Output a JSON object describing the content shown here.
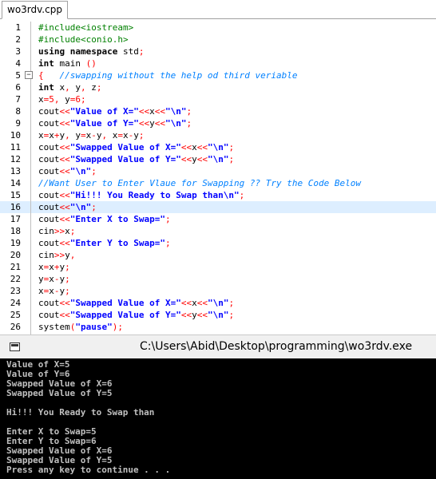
{
  "editor": {
    "tab_label": "wo3rdv.cpp",
    "highlighted_line": 16,
    "lines": [
      {
        "n": "1",
        "parts": [
          [
            "pp",
            "#include<iostream>"
          ]
        ]
      },
      {
        "n": "2",
        "parts": [
          [
            "pp",
            "#include<conio.h>"
          ]
        ]
      },
      {
        "n": "3",
        "parts": [
          [
            "kw",
            "using namespace"
          ],
          [
            "pl",
            " std"
          ],
          [
            "op",
            ";"
          ]
        ]
      },
      {
        "n": "4",
        "parts": [
          [
            "kw",
            "int"
          ],
          [
            "pl",
            " main "
          ],
          [
            "op",
            "()"
          ]
        ]
      },
      {
        "n": "5",
        "parts": [
          [
            "op",
            "{"
          ],
          [
            "cm",
            "   //swapping without the help od third veriable"
          ]
        ]
      },
      {
        "n": "6",
        "parts": [
          [
            "kw",
            "int"
          ],
          [
            "pl",
            " x"
          ],
          [
            "op",
            ","
          ],
          [
            "pl",
            " y"
          ],
          [
            "op",
            ","
          ],
          [
            "pl",
            " z"
          ],
          [
            "op",
            ";"
          ]
        ]
      },
      {
        "n": "7",
        "parts": [
          [
            "pl",
            "x"
          ],
          [
            "op",
            "="
          ],
          [
            "nm",
            "5"
          ],
          [
            "op",
            ","
          ],
          [
            "pl",
            " y"
          ],
          [
            "op",
            "="
          ],
          [
            "nm",
            "6"
          ],
          [
            "op",
            ";"
          ]
        ]
      },
      {
        "n": "8",
        "parts": [
          [
            "pl",
            "cout"
          ],
          [
            "op",
            "<<"
          ],
          [
            "st",
            "\"Value of X=\""
          ],
          [
            "op",
            "<<"
          ],
          [
            "pl",
            "x"
          ],
          [
            "op",
            "<<"
          ],
          [
            "st",
            "\"\\n\""
          ],
          [
            "op",
            ";"
          ]
        ]
      },
      {
        "n": "9",
        "parts": [
          [
            "pl",
            "cout"
          ],
          [
            "op",
            "<<"
          ],
          [
            "st",
            "\"Value of Y=\""
          ],
          [
            "op",
            "<<"
          ],
          [
            "pl",
            "y"
          ],
          [
            "op",
            "<<"
          ],
          [
            "st",
            "\"\\n\""
          ],
          [
            "op",
            ";"
          ]
        ]
      },
      {
        "n": "10",
        "parts": [
          [
            "pl",
            "x"
          ],
          [
            "op",
            "="
          ],
          [
            "pl",
            "x"
          ],
          [
            "op",
            "+"
          ],
          [
            "pl",
            "y"
          ],
          [
            "op",
            ","
          ],
          [
            "pl",
            " y"
          ],
          [
            "op",
            "="
          ],
          [
            "pl",
            "x"
          ],
          [
            "op",
            "-"
          ],
          [
            "pl",
            "y"
          ],
          [
            "op",
            ","
          ],
          [
            "pl",
            " x"
          ],
          [
            "op",
            "="
          ],
          [
            "pl",
            "x"
          ],
          [
            "op",
            "-"
          ],
          [
            "pl",
            "y"
          ],
          [
            "op",
            ";"
          ]
        ]
      },
      {
        "n": "11",
        "parts": [
          [
            "pl",
            "cout"
          ],
          [
            "op",
            "<<"
          ],
          [
            "st",
            "\"Swapped Value of X=\""
          ],
          [
            "op",
            "<<"
          ],
          [
            "pl",
            "x"
          ],
          [
            "op",
            "<<"
          ],
          [
            "st",
            "\"\\n\""
          ],
          [
            "op",
            ";"
          ]
        ]
      },
      {
        "n": "12",
        "parts": [
          [
            "pl",
            "cout"
          ],
          [
            "op",
            "<<"
          ],
          [
            "st",
            "\"Swapped Value of Y=\""
          ],
          [
            "op",
            "<<"
          ],
          [
            "pl",
            "y"
          ],
          [
            "op",
            "<<"
          ],
          [
            "st",
            "\"\\n\""
          ],
          [
            "op",
            ";"
          ]
        ]
      },
      {
        "n": "13",
        "parts": [
          [
            "pl",
            "cout"
          ],
          [
            "op",
            "<<"
          ],
          [
            "st",
            "\"\\n\""
          ],
          [
            "op",
            ";"
          ]
        ]
      },
      {
        "n": "14",
        "parts": [
          [
            "cm",
            "//Want User to Enter Vlaue for Swapping ?? Try the Code Below"
          ]
        ]
      },
      {
        "n": "15",
        "parts": [
          [
            "pl",
            "cout"
          ],
          [
            "op",
            "<<"
          ],
          [
            "st",
            "\"Hi!!! You Ready to Swap than\\n\""
          ],
          [
            "op",
            ";"
          ]
        ]
      },
      {
        "n": "16",
        "parts": [
          [
            "pl",
            "cout"
          ],
          [
            "op",
            "<<"
          ],
          [
            "st",
            "\"\\n\""
          ],
          [
            "op",
            ";"
          ]
        ]
      },
      {
        "n": "17",
        "parts": [
          [
            "pl",
            "cout"
          ],
          [
            "op",
            "<<"
          ],
          [
            "st",
            "\"Enter X to Swap=\""
          ],
          [
            "op",
            ";"
          ]
        ]
      },
      {
        "n": "18",
        "parts": [
          [
            "pl",
            "cin"
          ],
          [
            "op",
            ">>"
          ],
          [
            "pl",
            "x"
          ],
          [
            "op",
            ";"
          ]
        ]
      },
      {
        "n": "19",
        "parts": [
          [
            "pl",
            "cout"
          ],
          [
            "op",
            "<<"
          ],
          [
            "st",
            "\"Enter Y to Swap=\""
          ],
          [
            "op",
            ";"
          ]
        ]
      },
      {
        "n": "20",
        "parts": [
          [
            "pl",
            "cin"
          ],
          [
            "op",
            ">>"
          ],
          [
            "pl",
            "y"
          ],
          [
            "op",
            ","
          ]
        ]
      },
      {
        "n": "21",
        "parts": [
          [
            "pl",
            "x"
          ],
          [
            "op",
            "="
          ],
          [
            "pl",
            "x"
          ],
          [
            "op",
            "+"
          ],
          [
            "pl",
            "y"
          ],
          [
            "op",
            ";"
          ]
        ]
      },
      {
        "n": "22",
        "parts": [
          [
            "pl",
            "y"
          ],
          [
            "op",
            "="
          ],
          [
            "pl",
            "x"
          ],
          [
            "op",
            "-"
          ],
          [
            "pl",
            "y"
          ],
          [
            "op",
            ";"
          ]
        ]
      },
      {
        "n": "23",
        "parts": [
          [
            "pl",
            "x"
          ],
          [
            "op",
            "="
          ],
          [
            "pl",
            "x"
          ],
          [
            "op",
            "-"
          ],
          [
            "pl",
            "y"
          ],
          [
            "op",
            ";"
          ]
        ]
      },
      {
        "n": "24",
        "parts": [
          [
            "pl",
            "cout"
          ],
          [
            "op",
            "<<"
          ],
          [
            "st",
            "\"Swapped Value of X=\""
          ],
          [
            "op",
            "<<"
          ],
          [
            "pl",
            "x"
          ],
          [
            "op",
            "<<"
          ],
          [
            "st",
            "\"\\n\""
          ],
          [
            "op",
            ";"
          ]
        ]
      },
      {
        "n": "25",
        "parts": [
          [
            "pl",
            "cout"
          ],
          [
            "op",
            "<<"
          ],
          [
            "st",
            "\"Swapped Value of Y=\""
          ],
          [
            "op",
            "<<"
          ],
          [
            "pl",
            "y"
          ],
          [
            "op",
            "<<"
          ],
          [
            "st",
            "\"\\n\""
          ],
          [
            "op",
            ";"
          ]
        ]
      },
      {
        "n": "26",
        "parts": [
          [
            "pl",
            "system"
          ],
          [
            "op",
            "("
          ],
          [
            "st",
            "\"pause\""
          ],
          [
            "op",
            ");"
          ]
        ]
      }
    ]
  },
  "console": {
    "title": "C:\\Users\\Abid\\Desktop\\programming\\wo3rdv.exe",
    "icon": "console-window-icon",
    "output_lines": [
      "Value of X=5",
      "Value of Y=6",
      "Swapped Value of X=6",
      "Swapped Value of Y=5",
      "",
      "Hi!!! You Ready to Swap than",
      "",
      "Enter X to Swap=5",
      "Enter Y to Swap=6",
      "Swapped Value of X=6",
      "Swapped Value of Y=5",
      "Press any key to continue . . ."
    ]
  }
}
